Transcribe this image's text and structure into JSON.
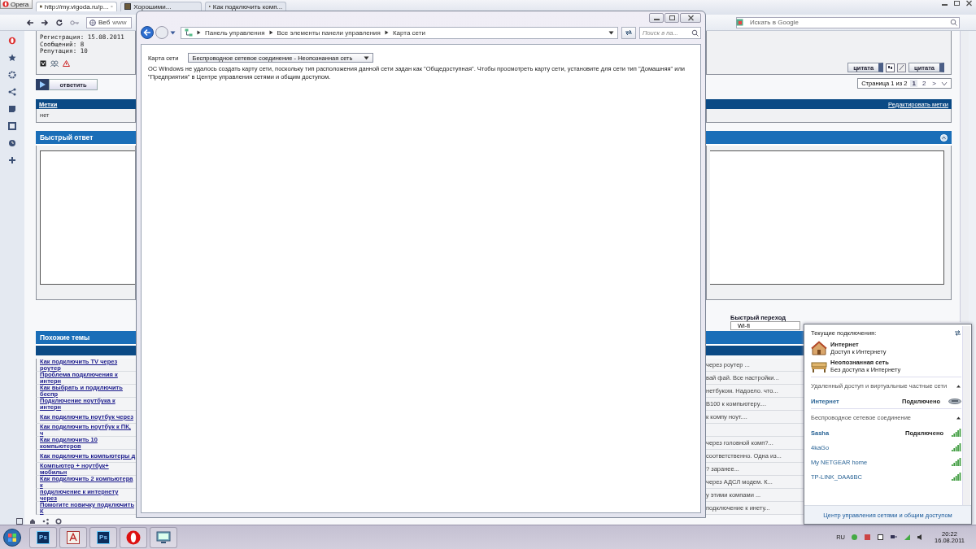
{
  "browser": {
    "menu_button": "Opera",
    "tabs": [
      {
        "label": "http://my.vigoda.ru/p...",
        "selected": true
      },
      {
        "label": "Хорошими...",
        "selected": false
      },
      {
        "label": "Как подключить комп...",
        "selected": false
      }
    ],
    "address": {
      "engine": "Веб",
      "value": "www"
    },
    "search": {
      "placeholder": "Искать в Google"
    }
  },
  "post": {
    "details": [
      "Регистрация: 15.08.2011",
      "Сообщений: 8",
      "Репутация: 10"
    ],
    "reply_button": "ответить",
    "action_buttons": [
      "цитата",
      "цитата"
    ]
  },
  "pagination": {
    "label": "Страница 1 из 2",
    "pages": [
      {
        "label": "1",
        "selected": true
      },
      {
        "label": "2",
        "selected": false
      }
    ],
    "next": ">"
  },
  "tags": {
    "title": "Метки",
    "edit_link": "Редактировать метки",
    "value": "нет"
  },
  "quick_reply": {
    "title": "Быстрый ответ"
  },
  "quick_nav": {
    "label": "Быстрый переход",
    "value": "Wi-fi"
  },
  "similar": {
    "title": "Похожие темы",
    "rows": [
      {
        "title": "Как подключить TV через роутер",
        "snippet": "через роутер ..."
      },
      {
        "title": "Проблема подключения к интерн",
        "snippet": "вай фай. Все настройки..."
      },
      {
        "title": "Как выбрать и подключить беспр",
        "snippet": "нетбуком. Надоело. что..."
      },
      {
        "title": "Подключение ноутбука к интерн",
        "snippet": "B100 к компьютеру...."
      },
      {
        "title": "Как подключить ноутбук через",
        "snippet": "к компу ноут...."
      },
      {
        "title": "Как подключить ноутбук к ПК, ч"
      },
      {
        "title": "Как подключить 10 компьютеров",
        "snippet": "через головной комп?..."
      },
      {
        "title": "Как подключить компьютеры д",
        "snippet": "соответственно. Одна из..."
      },
      {
        "title": "Компьютер + ноутбук+ мобильн",
        "snippet": "? заранее..."
      },
      {
        "title": "Как подключить 2 компьютера к",
        "snippet": "через АДСЛ модем. К..."
      },
      {
        "title": "подключение к интернету через",
        "snippet": "у этими компами ..."
      },
      {
        "title": "Помогите новичку подключить К",
        "snippet": "подключение к инету..."
      }
    ]
  },
  "explorer": {
    "breadcrumbs": [
      "Панель управления",
      "Все элементы панели управления",
      "Карта сети"
    ],
    "search_placeholder": "Поиск в па...",
    "map_label": "Карта сети",
    "network_select": "Беспроводное сетевое соединение - Неопознанная сеть",
    "message": "ОС Windows не удалось создать карту сети, поскольку тип расположения данной сети задан как \"Общедоступная\". Чтобы просмотреть карту сети, установите для сети тип \"Домашняя\" или \"Предприятия\" в Центре управления сетями и общим доступом."
  },
  "network_popup": {
    "current_title": "Текущие подключения:",
    "connections": [
      {
        "kind": "house",
        "name": "Интернет",
        "status": "Доступ к Интернету"
      },
      {
        "kind": "bench",
        "name": "Неопознанная сеть",
        "status": "Без доступа к Интернету"
      }
    ],
    "groups": [
      {
        "title": "Удаленный доступ и виртуальные частные сети",
        "expanded": true,
        "items": [
          {
            "kind": "dialup",
            "name": "Интернет",
            "connected": true,
            "status": "Подключено"
          }
        ]
      },
      {
        "title": "Беспроводное сетевое соединение",
        "expanded": true,
        "items": [
          {
            "kind": "wifi",
            "name": "Sasha",
            "connected": true,
            "status": "Подключено"
          },
          {
            "kind": "wifi",
            "name": "4kaGo",
            "connected": false
          },
          {
            "kind": "wifi",
            "name": "My NETGEAR home",
            "connected": false
          },
          {
            "kind": "wifi",
            "name": "TP-LINK_DAA6BC",
            "connected": false
          }
        ]
      }
    ],
    "footer_link": "Центр управления сетями и общим доступом"
  },
  "taskbar": {
    "apps": [
      {
        "kind": "ps",
        "label": "Ps"
      },
      {
        "kind": "acrobat"
      },
      {
        "kind": "ps",
        "label": "Ps"
      },
      {
        "kind": "opera"
      },
      {
        "kind": "network"
      }
    ],
    "language": "RU",
    "time": "20:22",
    "date": "16.08.2011"
  }
}
